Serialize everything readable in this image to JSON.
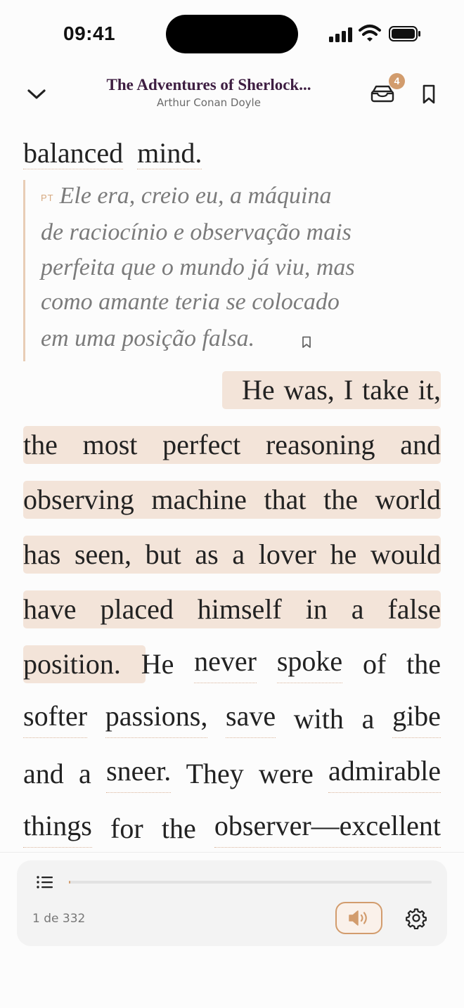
{
  "status_bar": {
    "time": "09:41"
  },
  "header": {
    "title": "The Adventures of Sherlock...",
    "author": "Arthur Conan Doyle",
    "inbox_badge": "4"
  },
  "reader": {
    "previous_line": [
      "balanced",
      "mind."
    ],
    "translation": {
      "language_tag": "PT",
      "lines": [
        "Ele era, creio eu, a máquina",
        "de raciocínio e observação mais",
        "perfeita que o mundo já viu, mas",
        "como amante teria se colocado",
        "em uma posição falsa."
      ]
    },
    "lines": [
      [
        "He",
        "was,",
        "I",
        "take",
        "it,"
      ],
      [
        "the",
        "most",
        "perfect",
        "reasoning",
        "and"
      ],
      [
        "observing",
        "machine",
        "that",
        "the",
        "world"
      ],
      [
        "has",
        "seen,",
        "but",
        "as",
        "a",
        "lover",
        "he",
        "would"
      ],
      [
        "have",
        "placed",
        "himself",
        "in",
        "a",
        "false"
      ],
      [
        "position.",
        "He",
        "never",
        "spoke",
        "of",
        "the"
      ],
      [
        "softer",
        "passions,",
        "save",
        "with",
        "a",
        "gibe"
      ],
      [
        "and",
        "a",
        "sneer.",
        "They",
        "were",
        "admirable"
      ],
      [
        "things",
        "for",
        "the",
        "observer—excellent"
      ]
    ]
  },
  "player": {
    "page_count": "1 de 332",
    "progress_fraction": 0.003,
    "accent_color": "#d29c6d",
    "highlight_color": "#f3e4d9",
    "title_color": "#3e1e42"
  },
  "icons": [
    "chevron-down-icon",
    "inbox-icon",
    "bookmark-icon",
    "list-icon",
    "speaker-icon",
    "gear-icon"
  ]
}
